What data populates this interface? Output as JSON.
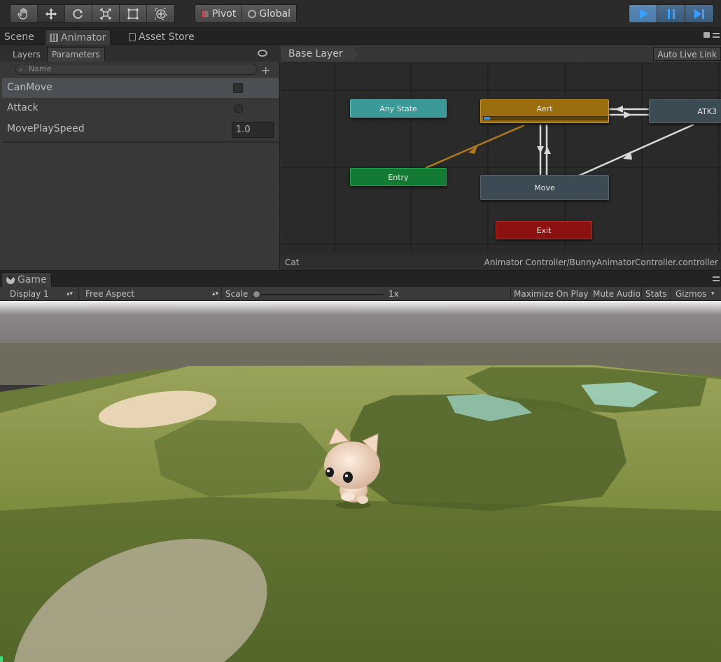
{
  "toolbar": {
    "pivot_label": "Pivot",
    "global_label": "Global"
  },
  "tabs": {
    "scene": "Scene",
    "animator": "Animator",
    "asset_store": "Asset Store"
  },
  "animator": {
    "sub_tabs": {
      "layers": "Layers",
      "parameters": "Parameters"
    },
    "search_placeholder": "Name",
    "parameters": [
      {
        "name": "CanMove",
        "type": "bool",
        "value": ""
      },
      {
        "name": "Attack",
        "type": "trigger",
        "value": ""
      },
      {
        "name": "MovePlaySpeed",
        "type": "float",
        "value": "1.0"
      }
    ],
    "layer_name": "Base Layer",
    "auto_live_link": "Auto Live Link",
    "states": {
      "any_state": "Any State",
      "entry": "Entry",
      "aert": "Aert",
      "atk": "ATK3",
      "move": "Move",
      "exit": "Exit"
    },
    "status_left": "Cat",
    "status_right": "Animator Controller/BunnyAnimatorController.controller"
  },
  "game": {
    "tab_label": "Game",
    "display": "Display 1",
    "aspect": "Free Aspect",
    "scale_label": "Scale",
    "scale_value": "1x",
    "maximize_on_play": "Maximize On Play",
    "mute_audio": "Mute Audio",
    "stats": "Stats",
    "gizmos": "Gizmos"
  }
}
